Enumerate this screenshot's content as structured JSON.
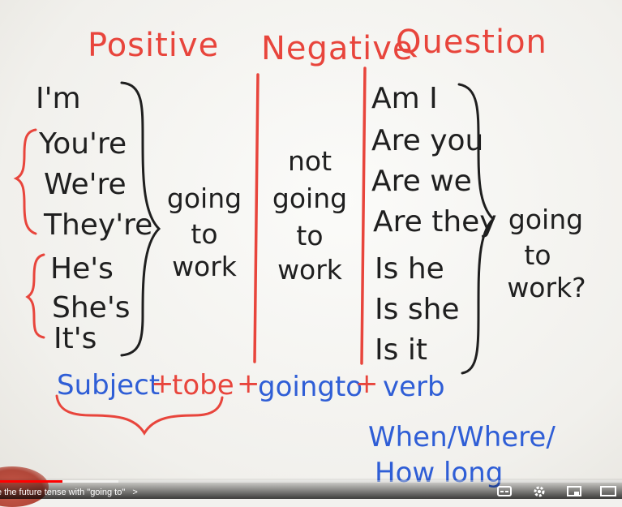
{
  "board": {
    "headers": {
      "positive": "Positive",
      "negative": "Negative",
      "question": "Question"
    },
    "positive_pronouns": [
      "I'm",
      "You're",
      "We're",
      "They're",
      "He's",
      "She's",
      "It's"
    ],
    "positive_middle": [
      "going",
      "to",
      "work"
    ],
    "negative_middle": [
      "not",
      "going",
      "to",
      "work"
    ],
    "question_pronouns": [
      "Am I",
      "Are you",
      "Are we",
      "Are they",
      "Is he",
      "Is she",
      "Is it"
    ],
    "question_end": [
      "going",
      "to",
      "work?"
    ],
    "formula": {
      "subject": "Subject",
      "plus1": "+",
      "tobe": "tobe",
      "plus2": "+",
      "goingto": "goingto",
      "plus3": "+",
      "verb": "verb"
    },
    "wh_words": [
      "When/Where/",
      "How long"
    ],
    "colors": {
      "red": "#e8453c",
      "black": "#1f1f1f",
      "blue": "#2f5ed6"
    }
  },
  "player": {
    "title": "e the future tense with \"going to\"",
    "title_chevron": ">",
    "progress_fraction": 0.1,
    "buffer_fraction": 0.19,
    "icons": [
      "subtitles-icon",
      "settings-icon",
      "miniplayer-icon",
      "theater-icon"
    ]
  }
}
